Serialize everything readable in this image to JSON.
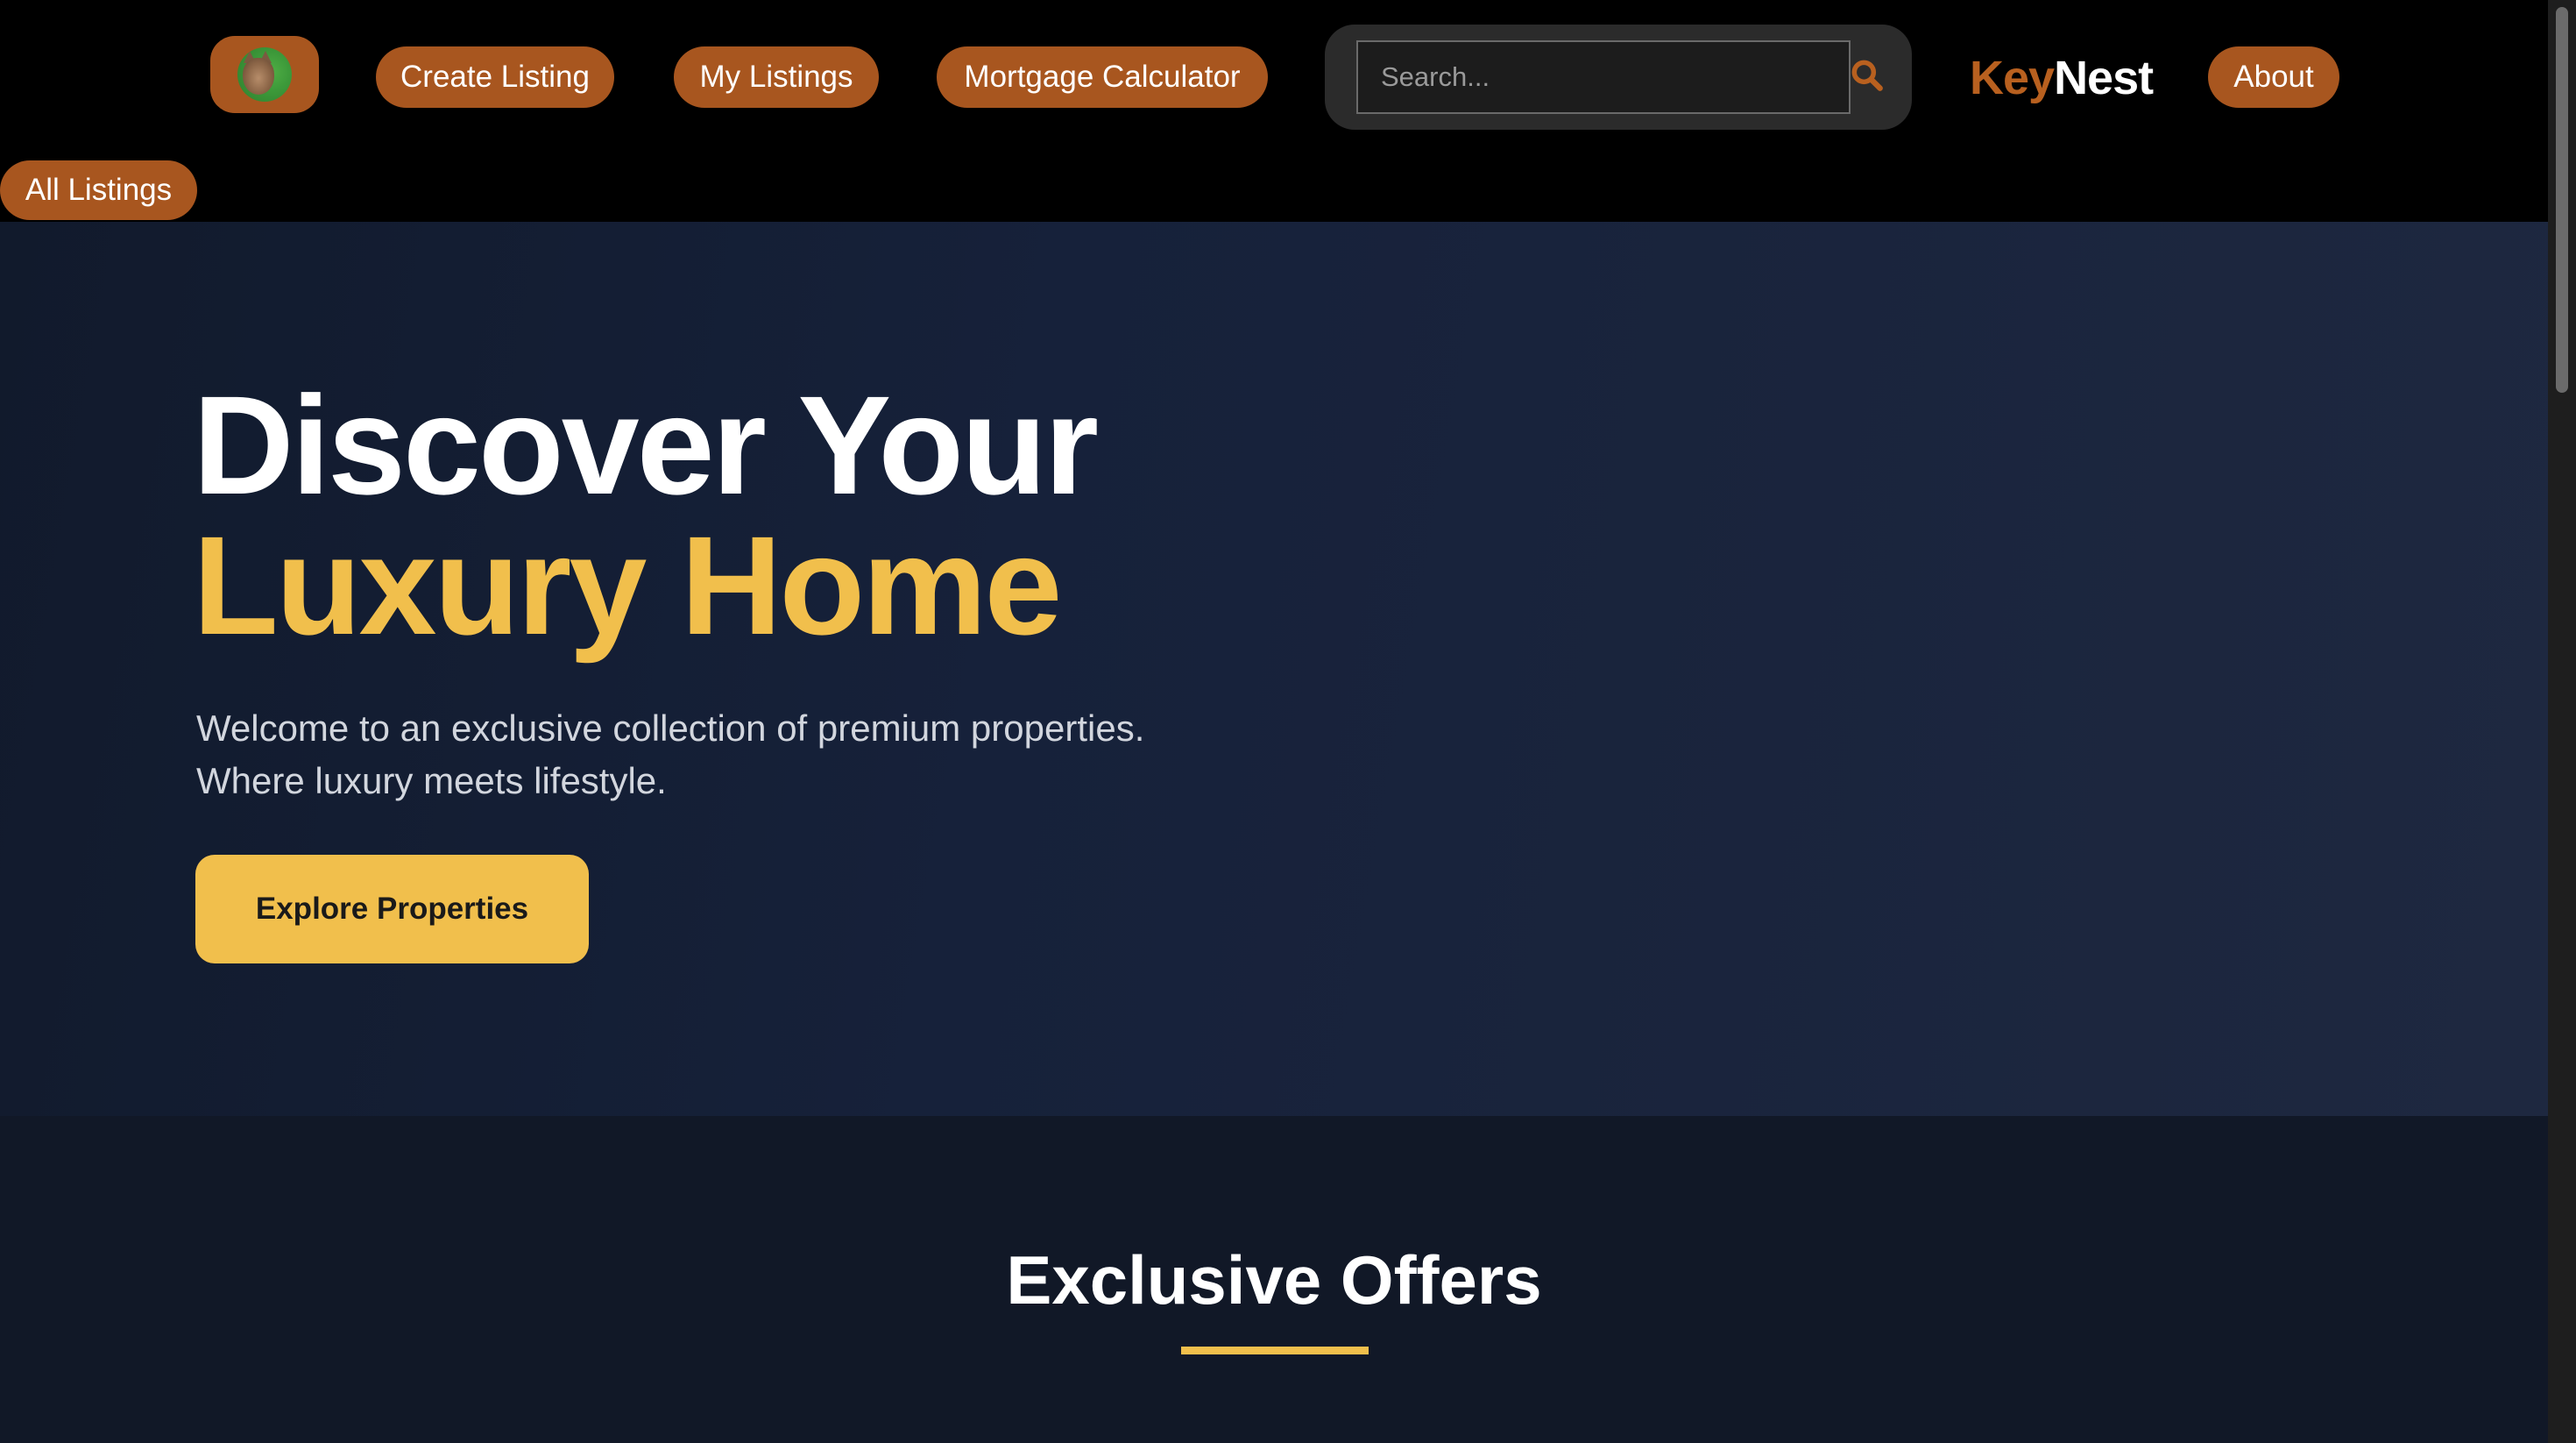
{
  "nav": {
    "avatar_alt": "User avatar",
    "create_listing": "Create Listing",
    "my_listings": "My Listings",
    "mortgage_calculator": "Mortgage Calculator",
    "search_placeholder": "Search...",
    "search_value": "",
    "brand_key": "Key",
    "brand_nest": "Nest",
    "about": "About",
    "all_listings": "All Listings"
  },
  "hero": {
    "title_line1": "Discover Your",
    "title_line2": "Luxury Home",
    "subtitle_line1": "Welcome to an exclusive collection of premium properties.",
    "subtitle_line2": "Where luxury meets lifestyle.",
    "cta": "Explore Properties"
  },
  "offers": {
    "title": "Exclusive Offers"
  },
  "icons": {
    "search": "search-icon",
    "avatar": "avatar-icon"
  },
  "colors": {
    "nav_pill": "#a8561f",
    "accent_gold": "#f1bf4c",
    "brand_orange": "#b8601f",
    "hero_bg": "#16213a",
    "page_bg": "#111827"
  }
}
